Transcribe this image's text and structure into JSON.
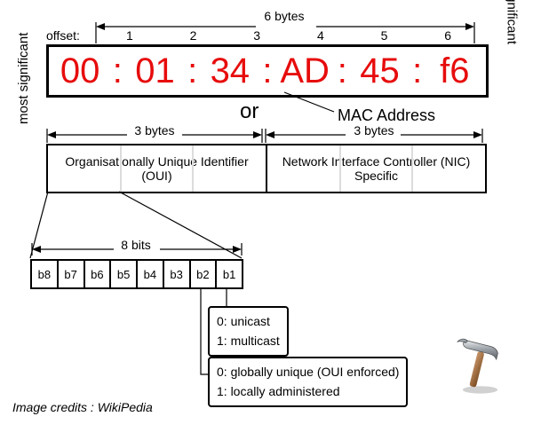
{
  "labels": {
    "offset": "offset:",
    "top_dim": "6 bytes",
    "most_sig": "most significant",
    "least_sig": "least significant",
    "or": "or",
    "mac_addr": "MAC Address",
    "sub_left": "3 bytes",
    "sub_right": "3 bytes",
    "oui": "Organisationally Unique Identifier (OUI)",
    "nic": "Network Interface Controller (NIC) Specific",
    "bits_dim": "8 bits",
    "credits": "Image credits : WikiPedia"
  },
  "offsets": [
    "1",
    "2",
    "3",
    "4",
    "5",
    "6"
  ],
  "mac": [
    "00",
    "01",
    "34",
    "AD",
    "45",
    "f6"
  ],
  "bits": [
    "b8",
    "b7",
    "b6",
    "b5",
    "b4",
    "b3",
    "b2",
    "b1"
  ],
  "b1": {
    "line0": "0: unicast",
    "line1": "1: multicast"
  },
  "b2": {
    "line0": "0: globally unique (OUI enforced)",
    "line1": "1: locally administered"
  }
}
